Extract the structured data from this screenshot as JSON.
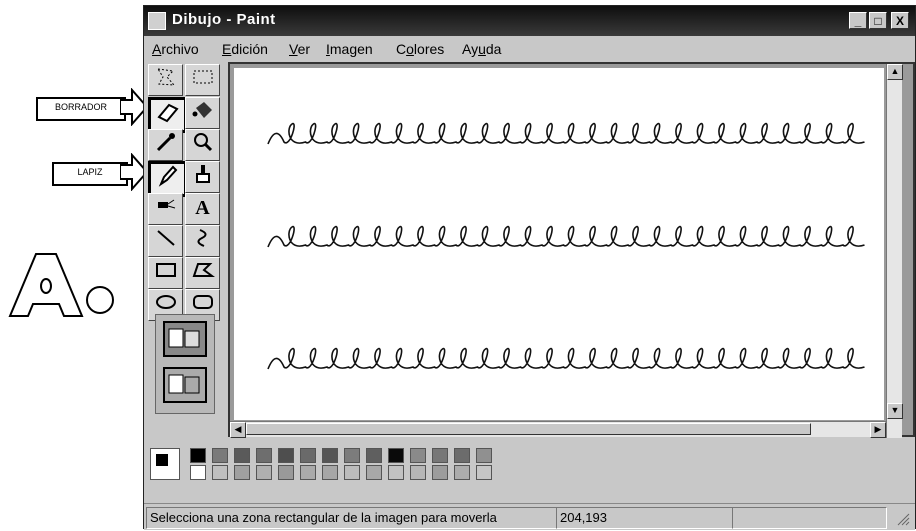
{
  "window": {
    "title": "Dibujo - Paint"
  },
  "title_buttons": [
    "_",
    "□",
    "X"
  ],
  "menu": [
    {
      "label": "Archivo",
      "accel_index": 0
    },
    {
      "label": "Edición",
      "accel_index": 0
    },
    {
      "label": "Ver",
      "accel_index": 0
    },
    {
      "label": "Imagen",
      "accel_index": 0
    },
    {
      "label": "Colores",
      "accel_index": 1
    },
    {
      "label": "Ayuda",
      "accel_index": 2
    }
  ],
  "tools": [
    {
      "name": "free-select-icon"
    },
    {
      "name": "rect-select-icon"
    },
    {
      "name": "eraser-icon",
      "selected": true
    },
    {
      "name": "fill-icon"
    },
    {
      "name": "color-picker-icon"
    },
    {
      "name": "magnifier-icon"
    },
    {
      "name": "pencil-icon",
      "selected": true
    },
    {
      "name": "brush-icon"
    },
    {
      "name": "airbrush-icon"
    },
    {
      "name": "text-icon",
      "glyph": "A"
    },
    {
      "name": "line-icon"
    },
    {
      "name": "curve-icon"
    },
    {
      "name": "rectangle-icon"
    },
    {
      "name": "polygon-icon"
    },
    {
      "name": "ellipse-icon"
    },
    {
      "name": "rounded-rect-icon"
    }
  ],
  "callouts": {
    "eraser": "BORRADOR",
    "pencil": "LAPIZ"
  },
  "palette": {
    "top_row": [
      "#000000",
      "#7a7a7a",
      "#5a5a5a",
      "#6e6e6e",
      "#4e4e4e",
      "#6a6a6a",
      "#555555",
      "#7c7c7c",
      "#5f5f5f",
      "#0a0a0a",
      "#8a8a8a",
      "#777777",
      "#6c6c6c",
      "#909090"
    ],
    "bottom_row": [
      "#ffffff",
      "#bfbfbf",
      "#a0a0a0",
      "#b0b0b0",
      "#999999",
      "#aaaaaa",
      "#a6a6a6",
      "#bcbcbc",
      "#a8a8a8",
      "#c2c2c2",
      "#b6b6b6",
      "#9c9c9c",
      "#acacac",
      "#c6c6c6"
    ]
  },
  "status": {
    "message": "Selecciona una zona rectangular de la imagen para moverla",
    "coords": "204,193"
  },
  "label_text": "A."
}
